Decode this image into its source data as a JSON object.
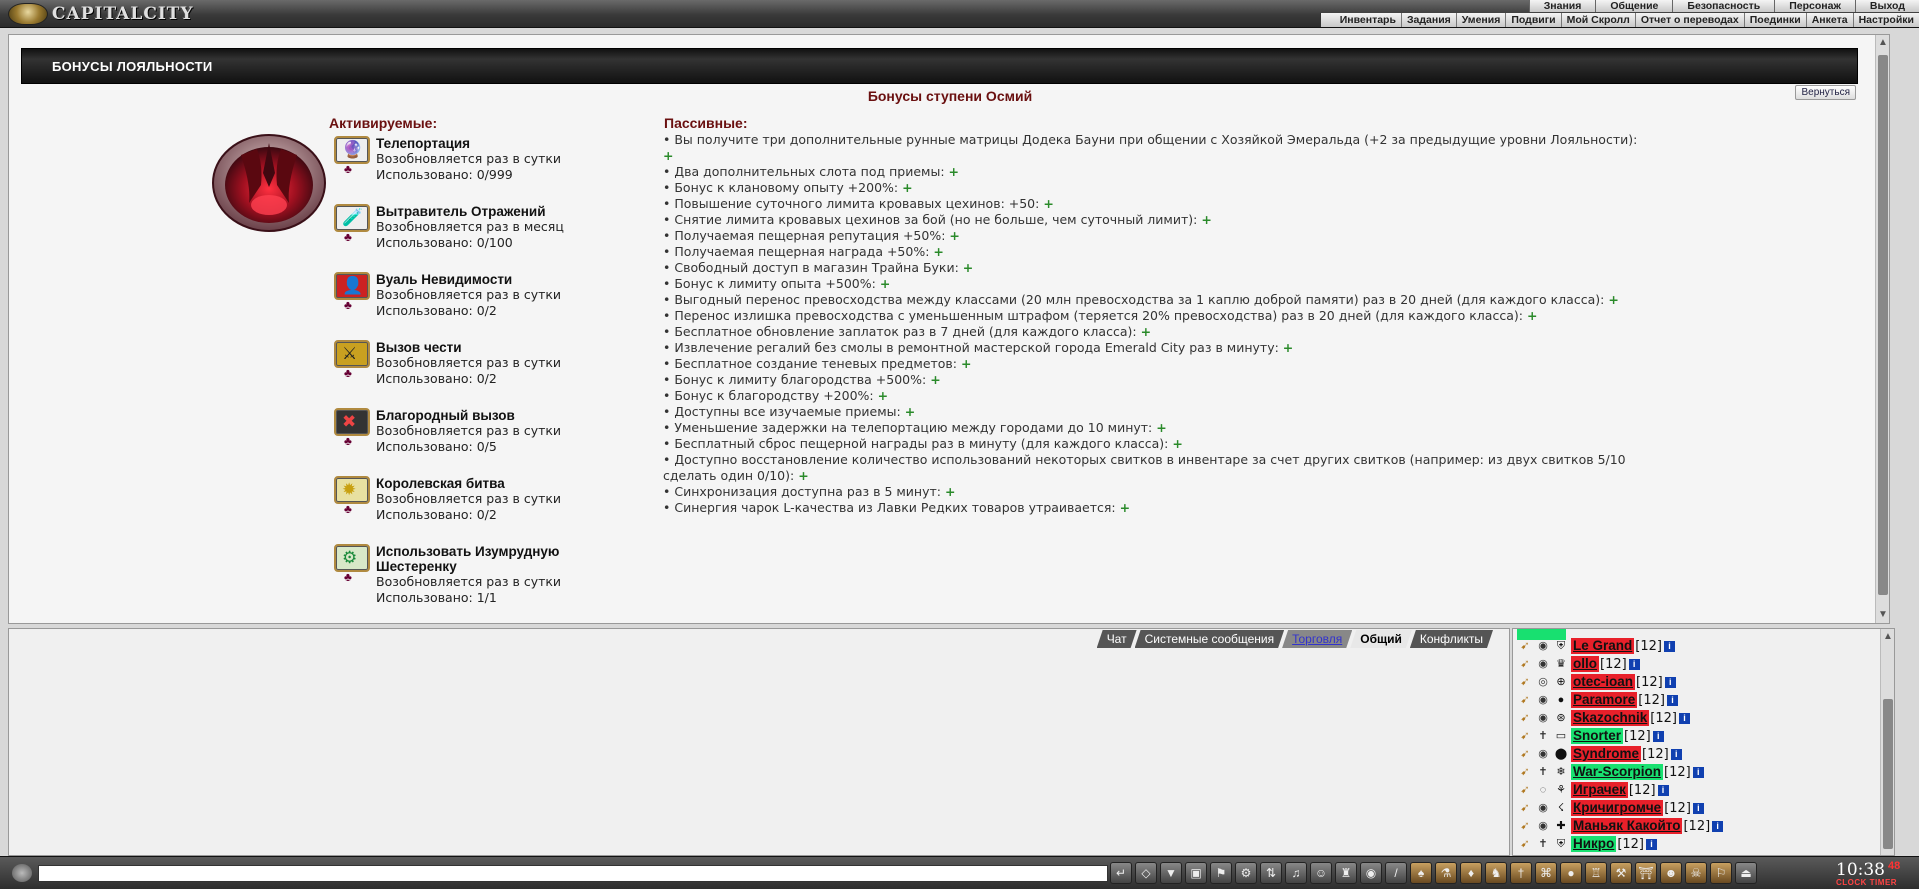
{
  "topbar": {
    "logo_text": "CAPITALCITY",
    "nav1": [
      "Знания",
      "Общение",
      "Безопасность",
      "Персонаж",
      "Выход"
    ],
    "nav2": [
      "Инвентарь",
      "Задания",
      "Умения",
      "Подвиги",
      "Мой Скролл",
      "Отчет о переводах",
      "Поединки",
      "Анкета",
      "Настройки"
    ]
  },
  "main": {
    "header_title": "БОНУСЫ ЛОЯЛЬНОСТИ",
    "tier_title": "Бонусы ступени Осмий",
    "return_label": "Вернуться",
    "active_title": "Активируемые:",
    "passive_title": "Пассивные:",
    "abilities": [
      {
        "name": "Телепортация",
        "renew": "Возобновляется раз в сутки",
        "used": "Использовано: 0/999",
        "icon": "teleport-icon"
      },
      {
        "name": "Вытравитель Отражений",
        "renew": "Возобновляется раз в месяц",
        "used": "Использовано: 0/100",
        "icon": "reflection-remover-icon"
      },
      {
        "name": "Вуаль Невидимости",
        "renew": "Возобновляется раз в сутки",
        "used": "Использовано: 0/2",
        "icon": "invisibility-veil-icon"
      },
      {
        "name": "Вызов чести",
        "renew": "Возобновляется раз в сутки",
        "used": "Использовано: 0/2",
        "icon": "honor-challenge-icon"
      },
      {
        "name": "Благородный вызов",
        "renew": "Возобновляется раз в сутки",
        "used": "Использовано: 0/5",
        "icon": "noble-challenge-icon"
      },
      {
        "name": "Королевская битва",
        "renew": "Возобновляется раз в сутки",
        "used": "Использовано: 0/2",
        "icon": "royal-battle-icon"
      },
      {
        "name": "Использовать Изумрудную Шестеренку",
        "renew": "Возобновляется раз в сутки",
        "used": "Использовано: 1/1",
        "icon": "emerald-gear-icon"
      }
    ],
    "passives": [
      "• Вы получите три дополнительные рунные матрицы Додека Бауни при общении с Хозяйкой Эмеральда (+2 за предыдущие уровни Лояльности):",
      "• Два дополнительных слота под приемы:",
      "• Бонус к клановому опыту +200%:",
      "• Повышение суточного лимита кровавых цехинов: +50:",
      "• Снятие лимита кровавых цехинов за бой (но не больше, чем суточный лимит):",
      "• Получаемая пещерная репутация +50%:",
      "• Получаемая пещерная награда +50%:",
      "• Свободный доступ в магазин Трайна Буки:",
      "• Бонус к лимиту опыта +500%:",
      "• Выгодный перенос превосходства между классами (20 млн превосходства за 1 каплю доброй памяти) раз в 20 дней (для каждого класса):",
      "• Перенос излишка превосходства с уменьшенным штрафом (теряется 20% превосходства) раз в 20 дней (для каждого класса):",
      "• Бесплатное обновление заплаток раз в 7 дней (для каждого класса):",
      "• Извлечение регалий без смолы в ремонтной мастерской города Emerald City раз в минуту:",
      "• Бесплатное создание теневых предметов:",
      "• Бонус к лимиту благородства +500%:",
      "• Бонус к благородству +200%:",
      "• Доступны все изучаемые приемы:",
      "• Уменьшение задержки на телепортацию между городами до 10 минут:",
      "• Бесплатный сброс пещерной награды раз в минуту (для каждого класса):",
      "• Доступно восстановление количество использований некоторых свитков в инвентаре за счет других свитков (например: из двух свитков 5/10 сделать один 0/10):",
      "• Синхронизация доступна раз в 5 минут:",
      "• Синергия чарок L-качества из Лавки Редких товаров утраивается:"
    ],
    "plus": "+"
  },
  "chat": {
    "tabs": [
      "Чат",
      "Системные сообщения",
      "Торговля",
      "Общий",
      "Конфликты"
    ],
    "input_value": ""
  },
  "users": [
    {
      "name": "Le Grand",
      "level": "[12]",
      "color": "red"
    },
    {
      "name": "ollo",
      "level": "[12]",
      "color": "red"
    },
    {
      "name": "otec-ioan",
      "level": "[12]",
      "color": "red"
    },
    {
      "name": "Paramore",
      "level": "[12]",
      "color": "red"
    },
    {
      "name": "Skazochnik",
      "level": "[12]",
      "color": "red"
    },
    {
      "name": "Snorter",
      "level": "[12]",
      "color": "green"
    },
    {
      "name": "Syndrome",
      "level": "[12]",
      "color": "red"
    },
    {
      "name": "War-Scorpion",
      "level": "[12]",
      "color": "green"
    },
    {
      "name": "Играчек",
      "level": "[12]",
      "color": "red"
    },
    {
      "name": "Кричигромче",
      "level": "[12]",
      "color": "red"
    },
    {
      "name": "Маньяк Какойто",
      "level": "[12]",
      "color": "red"
    },
    {
      "name": "Никро",
      "level": "[12]",
      "color": "green"
    }
  ],
  "clock": {
    "time": "10:38",
    "seconds": "48",
    "labels": "CLOCK TIMER"
  },
  "colors": {
    "red_name": "#e8202a",
    "green_name": "#18e070",
    "accent": "#6a1010",
    "plus": "#2a8a2a"
  }
}
